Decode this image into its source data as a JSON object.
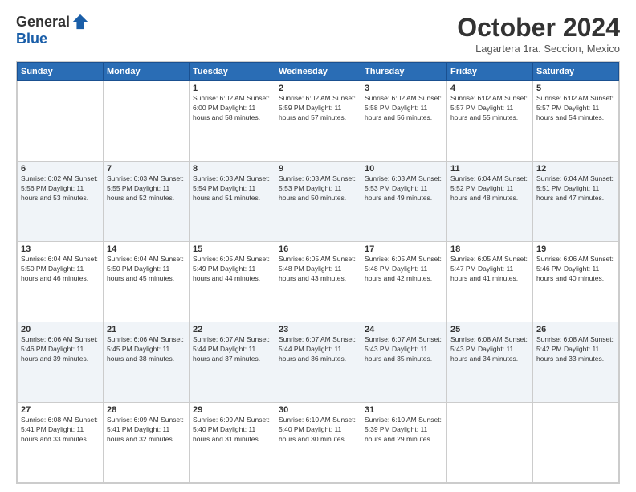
{
  "header": {
    "logo": {
      "general": "General",
      "blue": "Blue"
    },
    "title": "October 2024",
    "location": "Lagartera 1ra. Seccion, Mexico"
  },
  "days_of_week": [
    "Sunday",
    "Monday",
    "Tuesday",
    "Wednesday",
    "Thursday",
    "Friday",
    "Saturday"
  ],
  "weeks": [
    [
      {
        "day": "",
        "info": ""
      },
      {
        "day": "",
        "info": ""
      },
      {
        "day": "1",
        "info": "Sunrise: 6:02 AM\nSunset: 6:00 PM\nDaylight: 11 hours and 58 minutes."
      },
      {
        "day": "2",
        "info": "Sunrise: 6:02 AM\nSunset: 5:59 PM\nDaylight: 11 hours and 57 minutes."
      },
      {
        "day": "3",
        "info": "Sunrise: 6:02 AM\nSunset: 5:58 PM\nDaylight: 11 hours and 56 minutes."
      },
      {
        "day": "4",
        "info": "Sunrise: 6:02 AM\nSunset: 5:57 PM\nDaylight: 11 hours and 55 minutes."
      },
      {
        "day": "5",
        "info": "Sunrise: 6:02 AM\nSunset: 5:57 PM\nDaylight: 11 hours and 54 minutes."
      }
    ],
    [
      {
        "day": "6",
        "info": "Sunrise: 6:02 AM\nSunset: 5:56 PM\nDaylight: 11 hours and 53 minutes."
      },
      {
        "day": "7",
        "info": "Sunrise: 6:03 AM\nSunset: 5:55 PM\nDaylight: 11 hours and 52 minutes."
      },
      {
        "day": "8",
        "info": "Sunrise: 6:03 AM\nSunset: 5:54 PM\nDaylight: 11 hours and 51 minutes."
      },
      {
        "day": "9",
        "info": "Sunrise: 6:03 AM\nSunset: 5:53 PM\nDaylight: 11 hours and 50 minutes."
      },
      {
        "day": "10",
        "info": "Sunrise: 6:03 AM\nSunset: 5:53 PM\nDaylight: 11 hours and 49 minutes."
      },
      {
        "day": "11",
        "info": "Sunrise: 6:04 AM\nSunset: 5:52 PM\nDaylight: 11 hours and 48 minutes."
      },
      {
        "day": "12",
        "info": "Sunrise: 6:04 AM\nSunset: 5:51 PM\nDaylight: 11 hours and 47 minutes."
      }
    ],
    [
      {
        "day": "13",
        "info": "Sunrise: 6:04 AM\nSunset: 5:50 PM\nDaylight: 11 hours and 46 minutes."
      },
      {
        "day": "14",
        "info": "Sunrise: 6:04 AM\nSunset: 5:50 PM\nDaylight: 11 hours and 45 minutes."
      },
      {
        "day": "15",
        "info": "Sunrise: 6:05 AM\nSunset: 5:49 PM\nDaylight: 11 hours and 44 minutes."
      },
      {
        "day": "16",
        "info": "Sunrise: 6:05 AM\nSunset: 5:48 PM\nDaylight: 11 hours and 43 minutes."
      },
      {
        "day": "17",
        "info": "Sunrise: 6:05 AM\nSunset: 5:48 PM\nDaylight: 11 hours and 42 minutes."
      },
      {
        "day": "18",
        "info": "Sunrise: 6:05 AM\nSunset: 5:47 PM\nDaylight: 11 hours and 41 minutes."
      },
      {
        "day": "19",
        "info": "Sunrise: 6:06 AM\nSunset: 5:46 PM\nDaylight: 11 hours and 40 minutes."
      }
    ],
    [
      {
        "day": "20",
        "info": "Sunrise: 6:06 AM\nSunset: 5:46 PM\nDaylight: 11 hours and 39 minutes."
      },
      {
        "day": "21",
        "info": "Sunrise: 6:06 AM\nSunset: 5:45 PM\nDaylight: 11 hours and 38 minutes."
      },
      {
        "day": "22",
        "info": "Sunrise: 6:07 AM\nSunset: 5:44 PM\nDaylight: 11 hours and 37 minutes."
      },
      {
        "day": "23",
        "info": "Sunrise: 6:07 AM\nSunset: 5:44 PM\nDaylight: 11 hours and 36 minutes."
      },
      {
        "day": "24",
        "info": "Sunrise: 6:07 AM\nSunset: 5:43 PM\nDaylight: 11 hours and 35 minutes."
      },
      {
        "day": "25",
        "info": "Sunrise: 6:08 AM\nSunset: 5:43 PM\nDaylight: 11 hours and 34 minutes."
      },
      {
        "day": "26",
        "info": "Sunrise: 6:08 AM\nSunset: 5:42 PM\nDaylight: 11 hours and 33 minutes."
      }
    ],
    [
      {
        "day": "27",
        "info": "Sunrise: 6:08 AM\nSunset: 5:41 PM\nDaylight: 11 hours and 33 minutes."
      },
      {
        "day": "28",
        "info": "Sunrise: 6:09 AM\nSunset: 5:41 PM\nDaylight: 11 hours and 32 minutes."
      },
      {
        "day": "29",
        "info": "Sunrise: 6:09 AM\nSunset: 5:40 PM\nDaylight: 11 hours and 31 minutes."
      },
      {
        "day": "30",
        "info": "Sunrise: 6:10 AM\nSunset: 5:40 PM\nDaylight: 11 hours and 30 minutes."
      },
      {
        "day": "31",
        "info": "Sunrise: 6:10 AM\nSunset: 5:39 PM\nDaylight: 11 hours and 29 minutes."
      },
      {
        "day": "",
        "info": ""
      },
      {
        "day": "",
        "info": ""
      }
    ]
  ]
}
